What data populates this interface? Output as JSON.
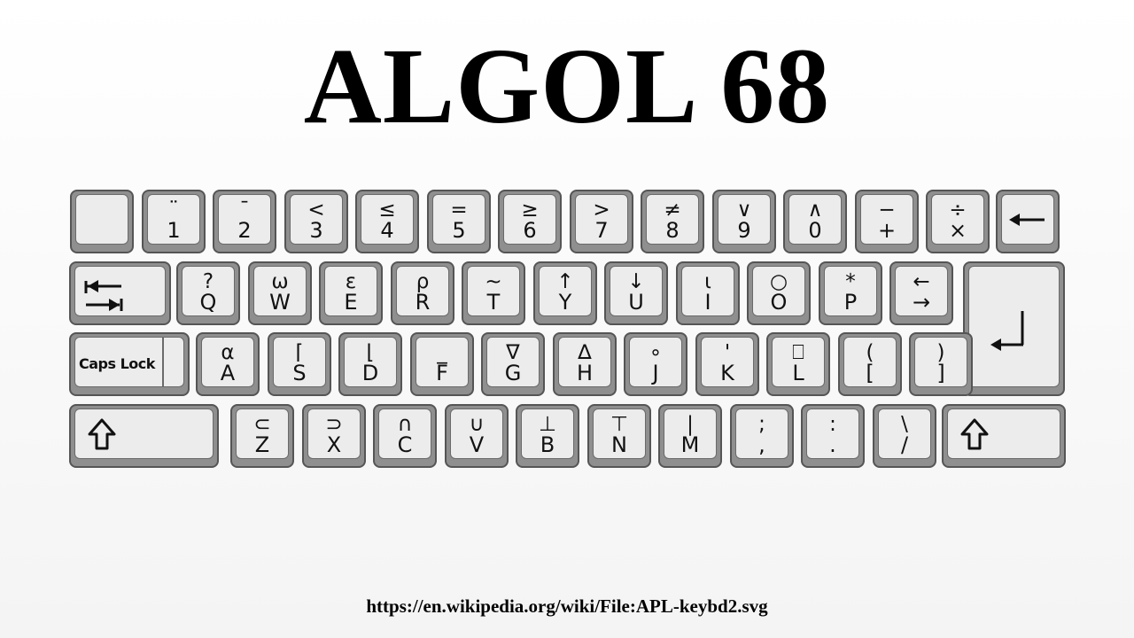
{
  "title": "ALGOL 68",
  "source": "https://en.wikipedia.org/wiki/File:APL-keybd2.svg",
  "keyboard": {
    "row1": [
      {
        "top": "",
        "bottom": ""
      },
      {
        "top": "¨",
        "bottom": "1"
      },
      {
        "top": "¯",
        "bottom": "2"
      },
      {
        "top": "<",
        "bottom": "3"
      },
      {
        "top": "≤",
        "bottom": "4"
      },
      {
        "top": "=",
        "bottom": "5"
      },
      {
        "top": "≥",
        "bottom": "6"
      },
      {
        "top": ">",
        "bottom": "7"
      },
      {
        "top": "≠",
        "bottom": "8"
      },
      {
        "top": "∨",
        "bottom": "9"
      },
      {
        "top": "∧",
        "bottom": "0"
      },
      {
        "top": "−",
        "bottom": "+"
      },
      {
        "top": "÷",
        "bottom": "×"
      }
    ],
    "row2": [
      {
        "top": "?",
        "bottom": "Q"
      },
      {
        "top": "ω",
        "bottom": "W"
      },
      {
        "top": "ε",
        "bottom": "E"
      },
      {
        "top": "ρ",
        "bottom": "R"
      },
      {
        "top": "~",
        "bottom": "T"
      },
      {
        "top": "↑",
        "bottom": "Y"
      },
      {
        "top": "↓",
        "bottom": "U"
      },
      {
        "top": "ι",
        "bottom": "I"
      },
      {
        "top": "○",
        "bottom": "O"
      },
      {
        "top": "*",
        "bottom": "P"
      },
      {
        "top": "←",
        "bottom": "→"
      }
    ],
    "row3": [
      {
        "top": "α",
        "bottom": "A"
      },
      {
        "top": "⌈",
        "bottom": "S"
      },
      {
        "top": "⌊",
        "bottom": "D"
      },
      {
        "top": "_",
        "bottom": "F"
      },
      {
        "top": "∇",
        "bottom": "G"
      },
      {
        "top": "∆",
        "bottom": "H"
      },
      {
        "top": "∘",
        "bottom": "J"
      },
      {
        "top": "'",
        "bottom": "K"
      },
      {
        "top": "⎕",
        "bottom": "L"
      },
      {
        "top": "(",
        "bottom": "["
      },
      {
        "top": ")",
        "bottom": "]"
      }
    ],
    "row4": [
      {
        "top": "⊂",
        "bottom": "Z"
      },
      {
        "top": "⊃",
        "bottom": "X"
      },
      {
        "top": "∩",
        "bottom": "C"
      },
      {
        "top": "∪",
        "bottom": "V"
      },
      {
        "top": "⊥",
        "bottom": "B"
      },
      {
        "top": "⊤",
        "bottom": "N"
      },
      {
        "top": "|",
        "bottom": "M"
      },
      {
        "top": ";",
        "bottom": ","
      },
      {
        "top": ":",
        "bottom": "."
      },
      {
        "top": "\\",
        "bottom": "/"
      }
    ],
    "caps_lock_label": "Caps Lock",
    "icons": {
      "backspace": "backspace-arrow-icon",
      "tab": "tab-arrows-icon",
      "enter": "enter-arrow-icon",
      "shift": "shift-arrow-icon"
    }
  }
}
